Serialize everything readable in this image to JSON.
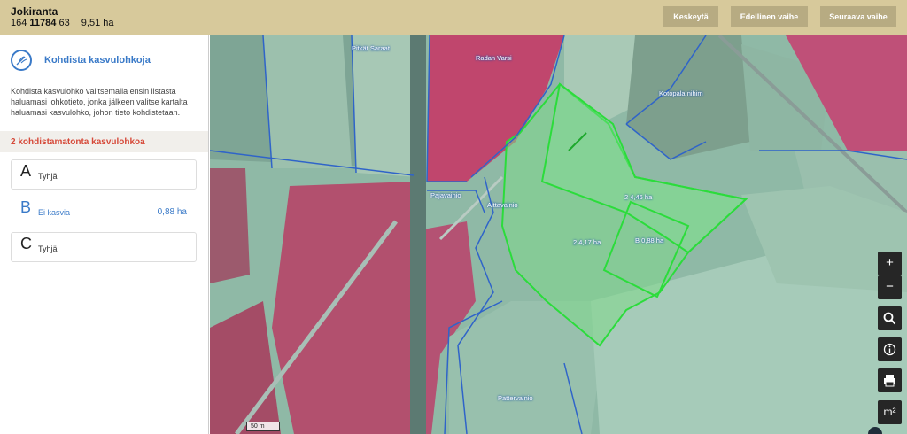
{
  "header": {
    "farm_name": "Jokiranta",
    "farm_id_prefix": "164",
    "farm_id_main": "11784",
    "farm_id_suffix": "63",
    "total_area": "9,51 ha",
    "buttons": {
      "stop": "Keskeytä",
      "previous": "Edellinen vaihe",
      "next": "Seuraava vaihe"
    },
    "colors": {
      "bar": "#d7c99b",
      "button": "#b7ab82"
    }
  },
  "sidebar": {
    "task_title": "Kohdista kasvulohkoja",
    "task_icon": "wheat-icon",
    "instructions": "Kohdista kasvulohko valitsemalla ensin listasta haluamasi lohkotieto, jonka jälkeen valitse kartalta haluamasi kasvulohko, johon tieto kohdistetaan.",
    "unassigned_label": "2 kohdistamatonta kasvulohkoa",
    "items": [
      {
        "letter": "A",
        "text": "Tyhjä",
        "area": ""
      },
      {
        "letter": "B",
        "text": "Ei kasvia",
        "area": "0,88 ha"
      },
      {
        "letter": "C",
        "text": "Tyhjä",
        "area": ""
      }
    ],
    "colors": {
      "accent": "#3a7ac8",
      "warning": "#d64a3a"
    }
  },
  "map": {
    "labels": {
      "l1": "Pitkät Saraat",
      "l2": "Radan Varsi",
      "l3": "Kotopala nihim",
      "l4": "Pajavainio",
      "l5": "Alttavainio",
      "l6": "2 4,46 ha",
      "l7": "B 0,88 ha",
      "l8": "2 4,17 ha",
      "l9": "Pattervainio"
    },
    "scale": "50 m",
    "controls": {
      "zoom_in": "+",
      "zoom_out": "−",
      "search": "⌕",
      "info": "i",
      "print": "⎙",
      "measure": "m²"
    }
  }
}
